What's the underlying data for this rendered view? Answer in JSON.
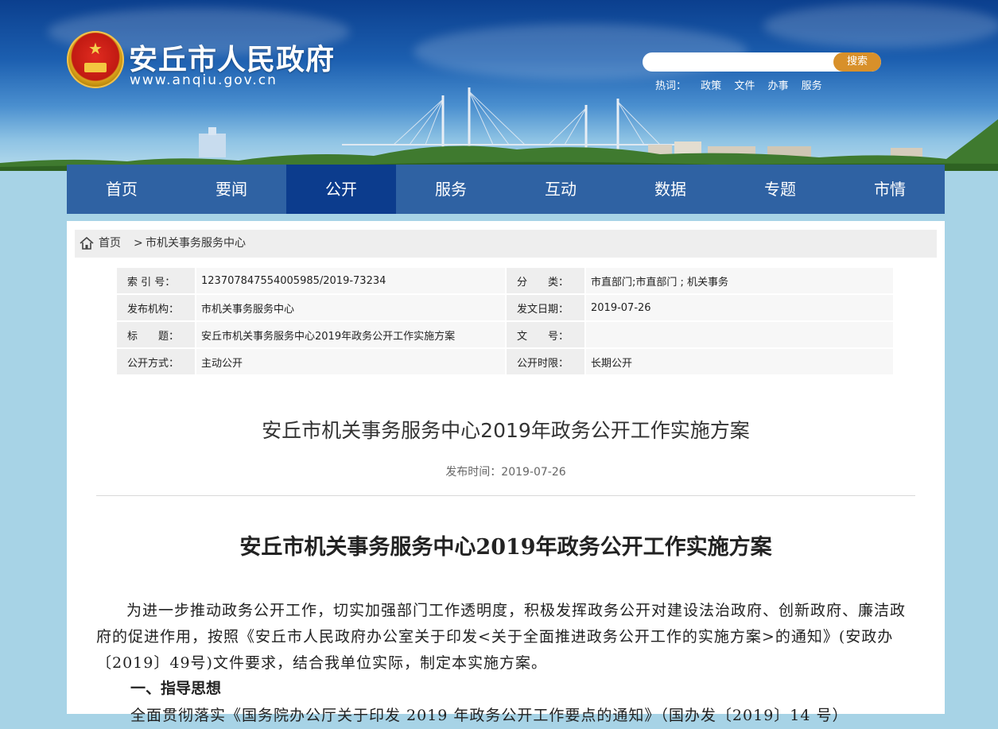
{
  "header": {
    "site_title": "安丘市人民政府",
    "site_domain": "www.anqiu.gov.cn",
    "seal_icon": "national-emblem-icon"
  },
  "search": {
    "placeholder": "",
    "button_label": "搜索",
    "hotwords_label": "热词：",
    "hotwords": [
      "政策",
      "文件",
      "办事",
      "服务"
    ]
  },
  "nav": {
    "items": [
      "首页",
      "要闻",
      "公开",
      "服务",
      "互动",
      "数据",
      "专题",
      "市情"
    ],
    "active": "公开"
  },
  "breadcrumb": {
    "home": "首页",
    "separator": ">",
    "current": "市机关事务服务中心"
  },
  "meta": {
    "index_label": "索 引 号：",
    "index_value": "123707847554005985/2019-73234",
    "category_label": "分　　类：",
    "category_value": "市直部门;市直部门 ; 机关事务",
    "publisher_label": "发布机构：",
    "publisher_value": "市机关事务服务中心",
    "date_label": "发文日期：",
    "date_value": "2019-07-26",
    "title_label": "标　　题：",
    "title_value": "安丘市机关事务服务中心2019年政务公开工作实施方案",
    "docno_label": "文　　号：",
    "docno_value": "",
    "mode_label": "公开方式：",
    "mode_value": "主动公开",
    "period_label": "公开时限：",
    "period_value": "长期公开"
  },
  "article": {
    "title": "安丘市机关事务服务中心2019年政务公开工作实施方案",
    "pub_date": "发布时间：2019-07-26",
    "heading": "安丘市机关事务服务中心2019年政务公开工作实施方案",
    "para1": "为进一步推动政务公开工作，切实加强部门工作透明度，积极发挥政务公开对建设法治政府、创新政府、廉洁政府的促进作用，按照《安丘市人民政府办公室关于印发<关于全面推进政务公开工作的实施方案>的通知》(安政办〔2019〕49号)文件要求，结合我单位实际，制定本实施方案。",
    "section1": "一、指导思想",
    "para2": "全面贯彻落实《国务院办公厅关于印发 2019 年政务公开工作要点的通知》（国办发〔2019〕14 号）"
  }
}
